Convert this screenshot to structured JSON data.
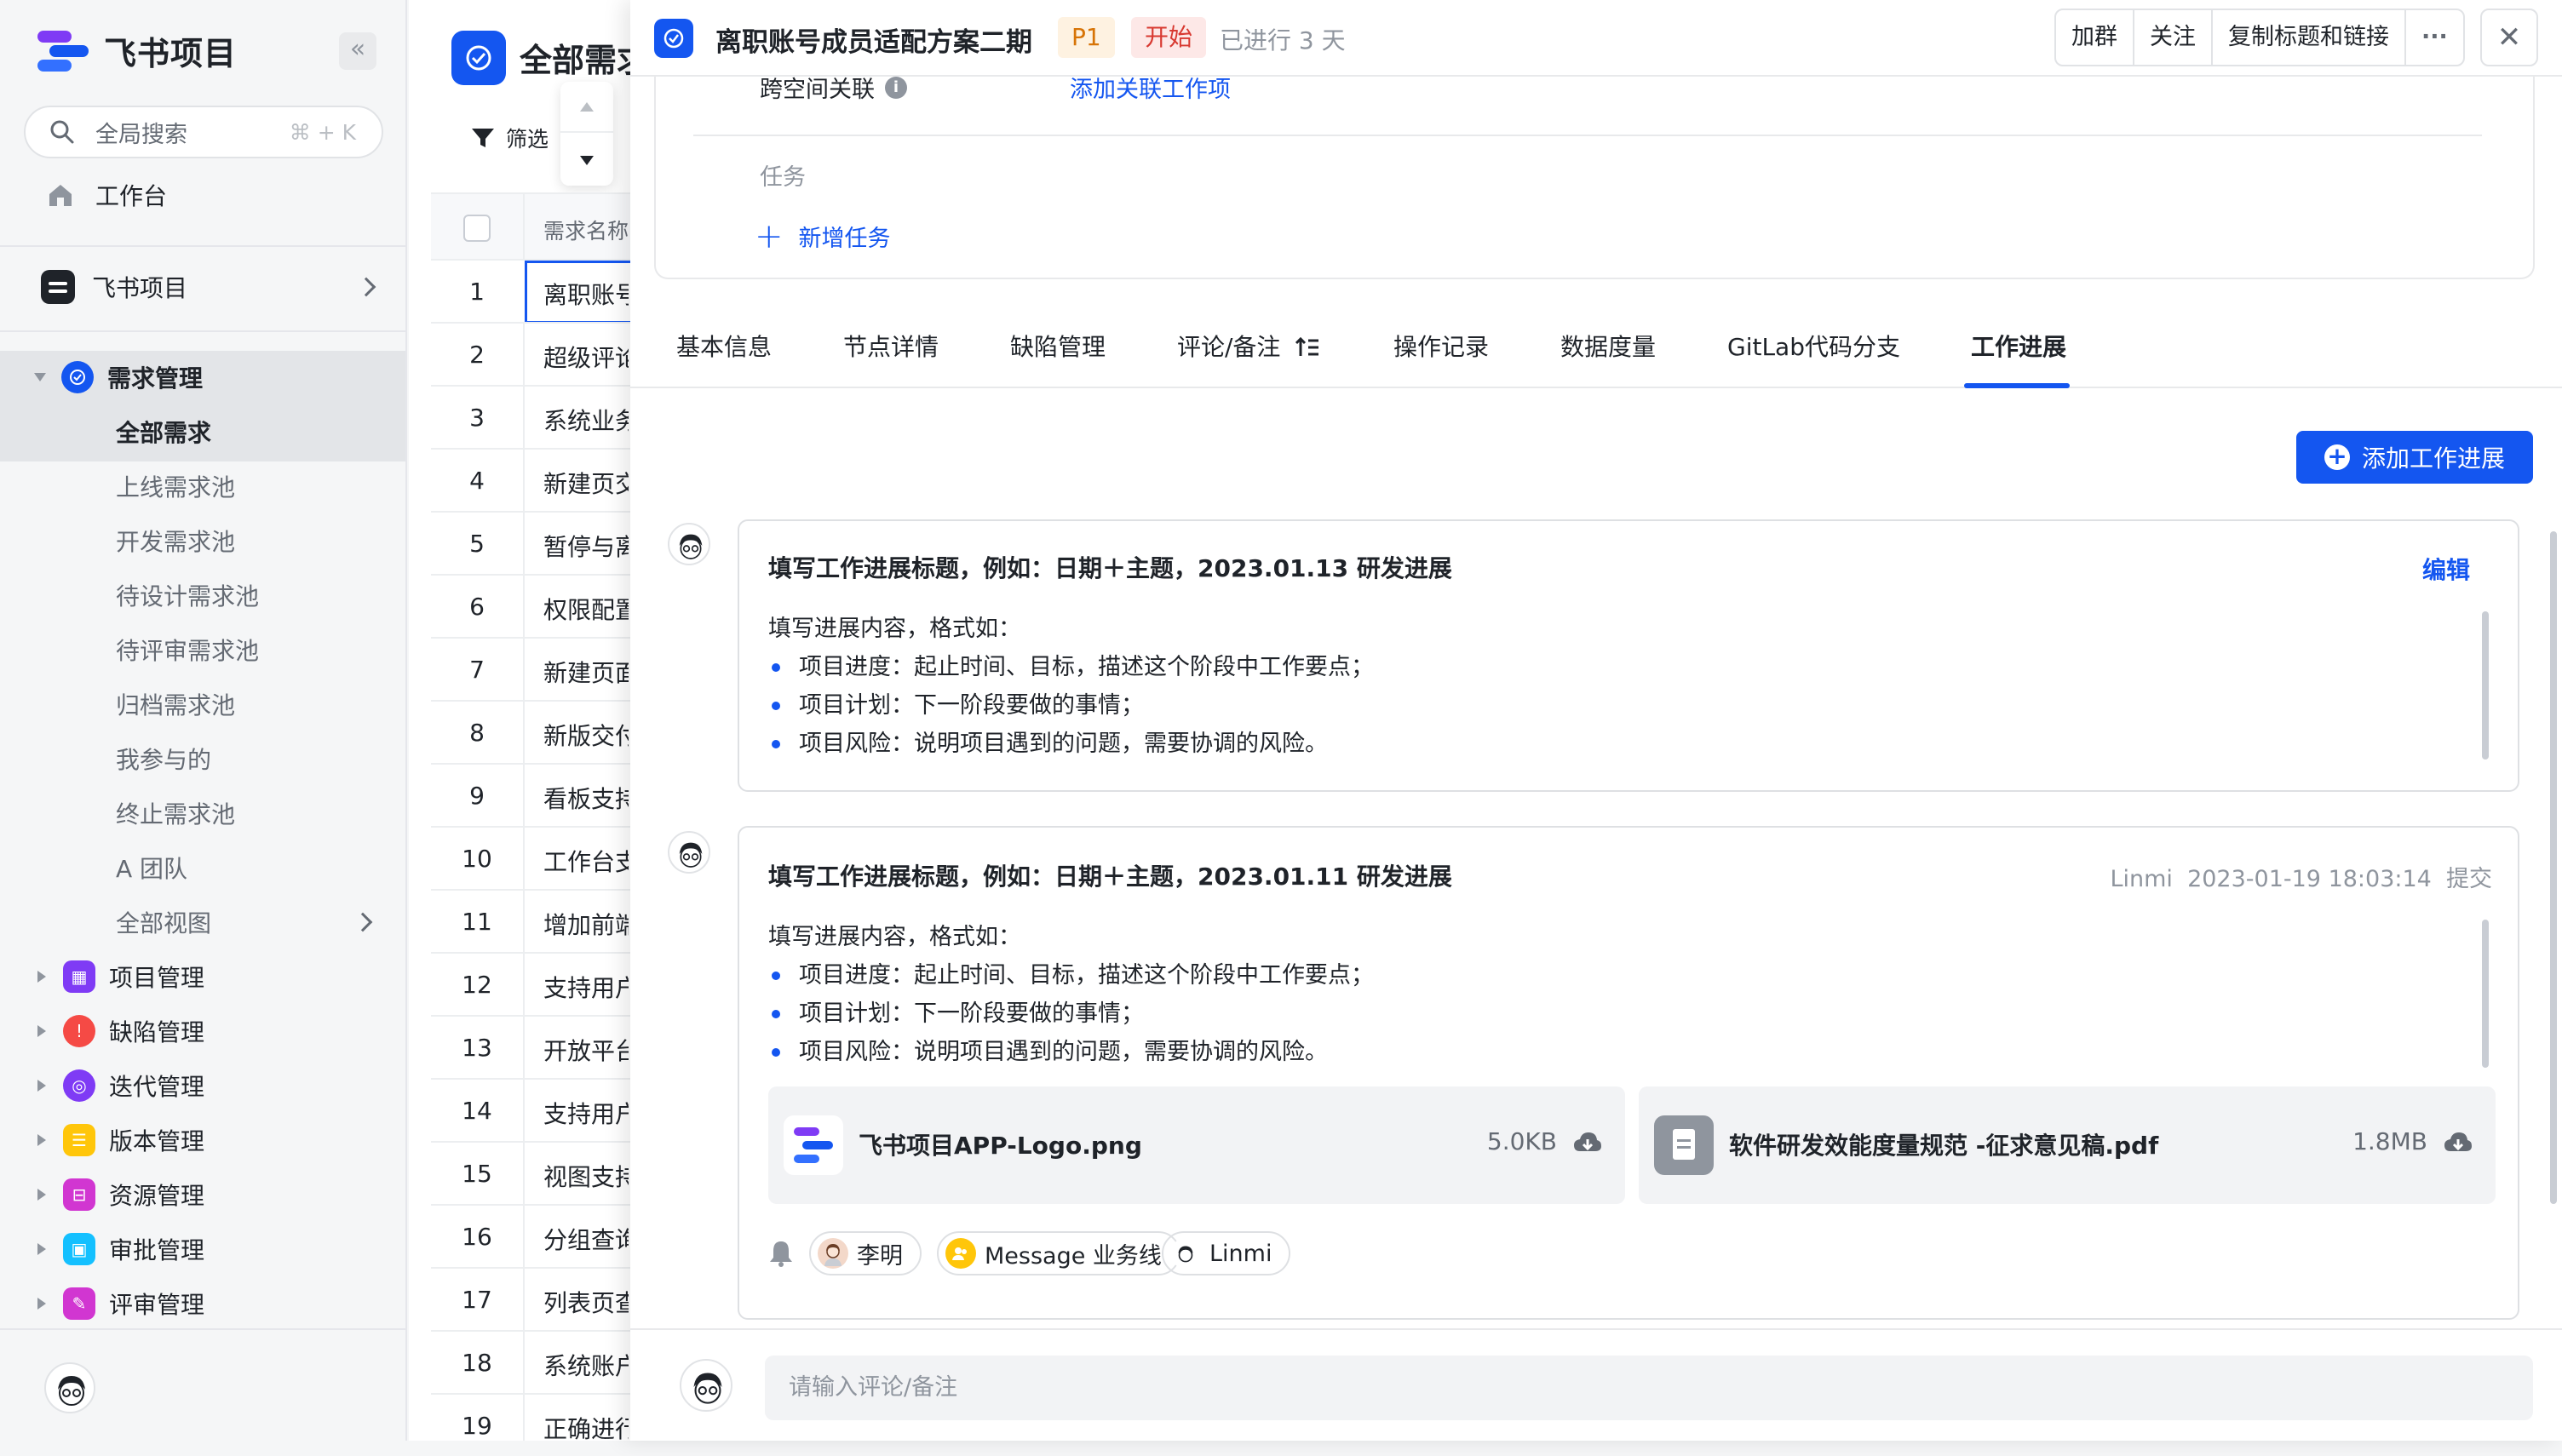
{
  "colors": {
    "primary": "#1456f0",
    "bg": "#f5f6f7",
    "p1_text": "#d77407",
    "p1_bg": "#fef2e1",
    "start_text": "#d83931",
    "start_bg": "#fde8e7"
  },
  "sidebar": {
    "brand": "飞书项目",
    "search_placeholder": "全局搜索",
    "search_shortcut": "⌘ + K",
    "workbench": "工作台",
    "space": "飞书项目",
    "modules": [
      {
        "label": "需求管理",
        "color": "#1456f0",
        "icon": "requirement-icon"
      },
      {
        "label": "项目管理",
        "color": "#7f3bf5",
        "icon": "project-icon"
      },
      {
        "label": "缺陷管理",
        "color": "#f54a45",
        "icon": "bug-icon"
      },
      {
        "label": "迭代管理",
        "color": "#7f3bf5",
        "icon": "iteration-icon"
      },
      {
        "label": "版本管理",
        "color": "#ffc60a",
        "icon": "version-icon"
      },
      {
        "label": "资源管理",
        "color": "#d136d1",
        "icon": "resource-icon"
      },
      {
        "label": "审批管理",
        "color": "#14c0ff",
        "icon": "approval-icon"
      },
      {
        "label": "评审管理",
        "color": "#d136d1",
        "icon": "review-icon"
      }
    ],
    "sub_items": [
      "全部需求",
      "上线需求池",
      "开发需求池",
      "待设计需求池",
      "待评审需求池",
      "归档需求池",
      "我参与的",
      "终止需求池",
      "A 团队",
      "全部视图"
    ]
  },
  "table": {
    "title": "全部需求",
    "filter_label": "筛选",
    "col_header": "需求名称",
    "rows": [
      {
        "num": "1",
        "name": "离职账号"
      },
      {
        "num": "2",
        "name": "超级评论"
      },
      {
        "num": "3",
        "name": "系统业务"
      },
      {
        "num": "4",
        "name": "新建页交"
      },
      {
        "num": "5",
        "name": "暂停与离"
      },
      {
        "num": "6",
        "name": "权限配置"
      },
      {
        "num": "7",
        "name": "新建页面"
      },
      {
        "num": "8",
        "name": "新版交付"
      },
      {
        "num": "9",
        "name": "看板支持"
      },
      {
        "num": "10",
        "name": "工作台支"
      },
      {
        "num": "11",
        "name": "增加前端"
      },
      {
        "num": "12",
        "name": "支持用户"
      },
      {
        "num": "13",
        "name": "开放平台"
      },
      {
        "num": "14",
        "name": "支持用户"
      },
      {
        "num": "15",
        "name": "视图支持"
      },
      {
        "num": "16",
        "name": "分组查询"
      },
      {
        "num": "17",
        "name": "列表页查"
      },
      {
        "num": "18",
        "name": "系统账户"
      },
      {
        "num": "19",
        "name": "正确进行"
      }
    ]
  },
  "panel": {
    "title": "离职账号成员适配方案二期",
    "priority": "P1",
    "status": "开始",
    "elapsed": "已进行 3 天",
    "actions": [
      "加群",
      "关注",
      "复制标题和链接"
    ],
    "more": "···",
    "close": "✕",
    "cross_space_label": "跨空间关联",
    "cross_space_link": "添加关联工作项",
    "task_label": "任务",
    "add_task": "新增任务",
    "tabs": [
      "基本信息",
      "节点详情",
      "缺陷管理",
      "评论/备注",
      "操作记录",
      "数据度量",
      "GitLab代码分支",
      "工作进展"
    ],
    "add_progress": "添加工作进展",
    "entries": [
      {
        "title": "填写工作进展标题，例如：日期＋主题，2023.01.13 研发进展",
        "edit": "编辑",
        "intro": "填写进展内容，格式如：",
        "bullets": [
          "项目进度：起止时间、目标，描述这个阶段中工作要点；",
          "项目计划：下一阶段要做的事情；",
          "项目风险：说明项目遇到的问题，需要协调的风险。"
        ]
      },
      {
        "title": "填写工作进展标题，例如：日期＋主题，2023.01.11 研发进展",
        "meta": "Linmi  2023-01-19 18:03:14  提交",
        "intro": "填写进展内容，格式如：",
        "bullets": [
          "项目进度：起止时间、目标，描述这个阶段中工作要点；",
          "项目计划：下一阶段要做的事情；",
          "项目风险：说明项目遇到的问题，需要协调的风险。"
        ],
        "files": [
          {
            "name": "飞书项目APP-Logo.png",
            "size": "5.0KB"
          },
          {
            "name": "软件研发效能度量规范 -征求意见稿.pdf",
            "size": "1.8MB"
          }
        ],
        "mentions": [
          "李明",
          "Message 业务线",
          "Linmi"
        ]
      }
    ],
    "comment_placeholder": "请输入评论/备注"
  }
}
